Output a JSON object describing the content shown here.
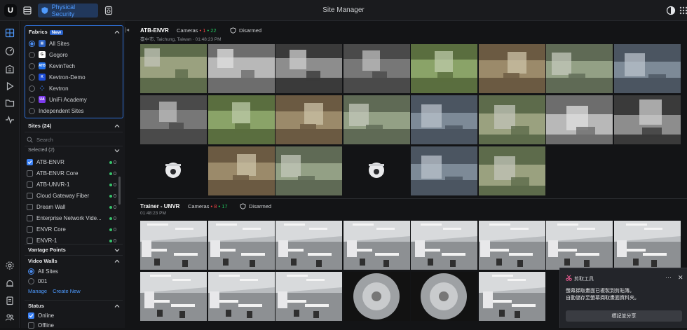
{
  "topbar": {
    "app_tab_label": "Physical Security",
    "title": "Site Manager",
    "icons": [
      "ubiquiti-logo-icon",
      "menu-icon",
      "shield-icon",
      "database-icon",
      "theme-toggle-icon",
      "apps-grid-icon"
    ]
  },
  "rail": {
    "icons": [
      "grid-icon",
      "dashboard-icon",
      "building-icon",
      "play-icon",
      "folder-icon",
      "pulse-icon",
      "settings-icon",
      "bell-icon",
      "clipboard-icon",
      "users-icon"
    ]
  },
  "sidebar": {
    "fabrics": {
      "title": "Fabrics",
      "badge": "New",
      "items": [
        {
          "label": "All Sites",
          "selected": true,
          "icon": "all-sites",
          "color": "#2b5fbf",
          "initials": ""
        },
        {
          "label": "Gogoro",
          "selected": false,
          "icon": "gogoro",
          "color": "#ffffff",
          "initials": ""
        },
        {
          "label": "KevinTech",
          "selected": false,
          "icon": "kevintech",
          "color": "#1f6feb",
          "initials": "ATB"
        },
        {
          "label": "Kevtron-Demo",
          "selected": false,
          "icon": "kevtron-demo",
          "color": "#1d4ed8",
          "initials": "K"
        },
        {
          "label": "Kevtron",
          "selected": false,
          "icon": "kevtron",
          "color": "#2563eb",
          "initials": ""
        },
        {
          "label": "UniFi Academy",
          "selected": false,
          "icon": "unifi-academy",
          "color": "#7c3aed",
          "initials": "UA"
        },
        {
          "label": "Independent Sites",
          "selected": false,
          "icon": "",
          "color": "",
          "initials": ""
        }
      ]
    },
    "sites": {
      "title": "Sites (24)",
      "search_placeholder": "Search",
      "selected_label": "Selected (2)",
      "items": [
        {
          "label": "ATB-ENVR",
          "checked": true,
          "count": "0"
        },
        {
          "label": "ATB-ENVR Core",
          "checked": false,
          "count": "0"
        },
        {
          "label": "ATB-UNVR-1",
          "checked": false,
          "count": "0"
        },
        {
          "label": "Cloud Gateway Fiber",
          "checked": false,
          "count": "0"
        },
        {
          "label": "Dream Wall",
          "checked": false,
          "count": "0"
        },
        {
          "label": "Enterprise Network Vide...",
          "checked": false,
          "count": "0"
        },
        {
          "label": "ENVR Core",
          "checked": false,
          "count": "0"
        },
        {
          "label": "ENVR-1",
          "checked": false,
          "count": "0"
        }
      ]
    },
    "vantage_points": {
      "title": "Vantage Points"
    },
    "video_walls": {
      "title": "Video Walls",
      "items": [
        {
          "label": "All Sites",
          "selected": true
        },
        {
          "label": "001",
          "selected": false
        }
      ],
      "manage_label": "Manage",
      "create_label": "Create New"
    },
    "status": {
      "title": "Status",
      "items": [
        {
          "label": "Online",
          "checked": true
        },
        {
          "label": "Offline",
          "checked": false
        }
      ]
    }
  },
  "nvrs": [
    {
      "name": "ATB-ENVR",
      "cameras_label": "Cameras",
      "offline_count": "1",
      "online_count": "22",
      "status": "Disarmed",
      "location": "臺中市, Taichung, Taiwan",
      "time": "01:48:23 PM"
    },
    {
      "name": "Trainer - UNVR",
      "cameras_label": "Cameras",
      "offline_count": "8",
      "online_count": "17",
      "status": "Disarmed",
      "location": "",
      "time": "01:48:23 PM"
    }
  ],
  "toast": {
    "app_name": "剪取工具",
    "message_line1": "螢幕擷取畫面已複製到剪貼簿。",
    "message_line2": "自動儲存至螢幕擷取畫面資料夾。",
    "button_label": "標記並分享"
  },
  "colors": {
    "accent": "#3b82f6",
    "online": "#22c55e",
    "offline": "#ef4444",
    "background": "#131416"
  }
}
